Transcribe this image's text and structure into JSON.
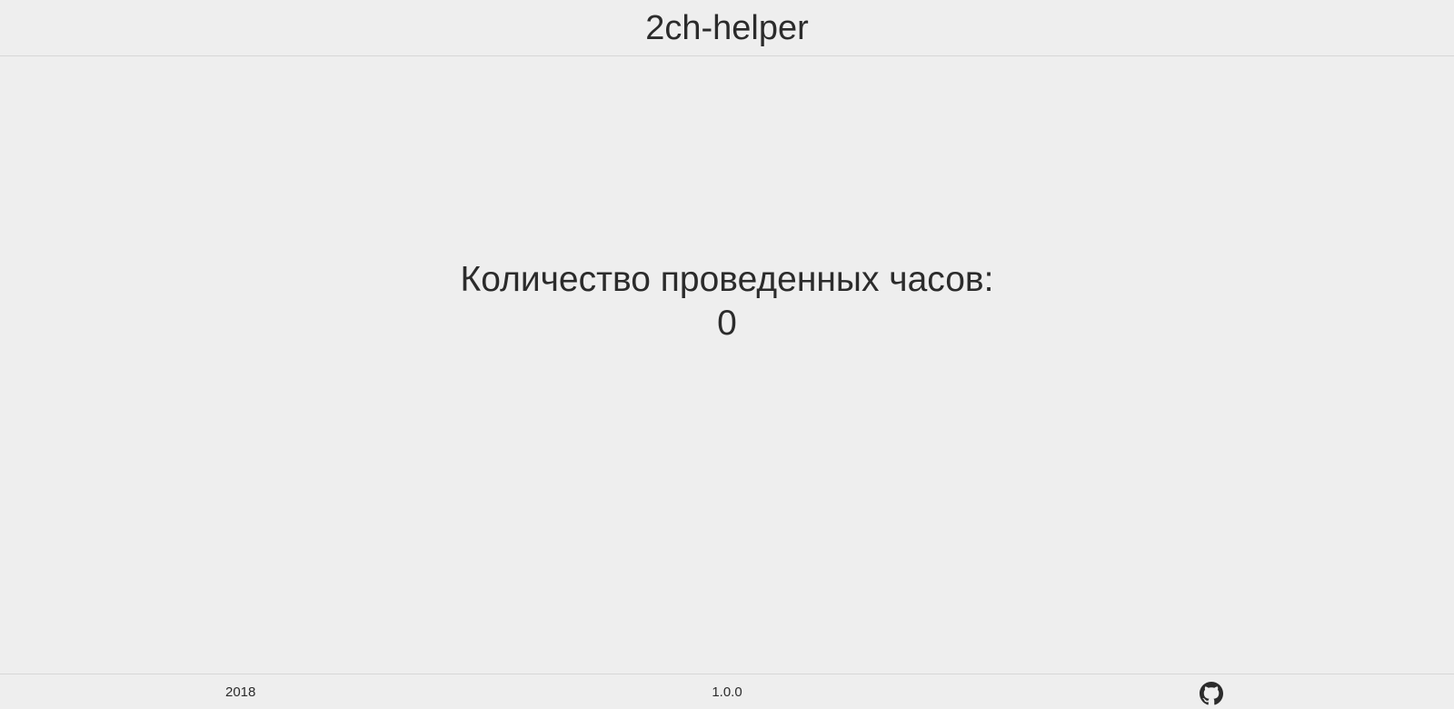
{
  "header": {
    "title": "2ch-helper"
  },
  "main": {
    "hours_label": "Количество проведенных часов:",
    "hours_value": "0"
  },
  "footer": {
    "year": "2018",
    "version": "1.0.0",
    "github_icon": "github-icon"
  },
  "colors": {
    "background": "#eeeeee",
    "text": "#2b2b2b",
    "divider": "#d6d6d6"
  }
}
